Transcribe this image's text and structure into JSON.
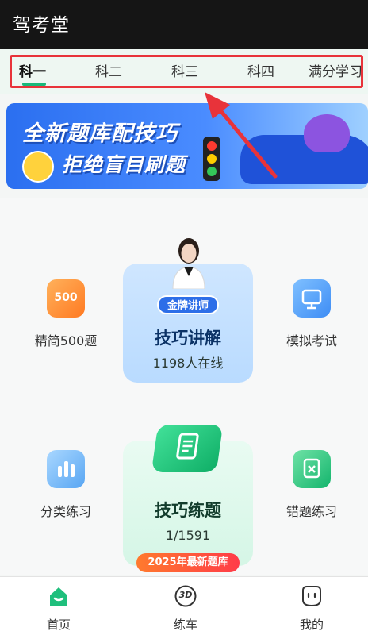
{
  "header": {
    "title": "驾考堂"
  },
  "tabs": [
    {
      "label": "科一",
      "active": true
    },
    {
      "label": "科二"
    },
    {
      "label": "科三"
    },
    {
      "label": "科四"
    },
    {
      "label": "满分学习"
    }
  ],
  "banner": {
    "line1": "全新题库配技巧",
    "line2": "拒绝盲目刷题"
  },
  "features": {
    "left_top": {
      "label": "精简500题",
      "icon": "500-icon",
      "icon_text": "500"
    },
    "right_top": {
      "label": "模拟考试",
      "icon": "monitor-icon"
    },
    "left_bottom": {
      "label": "分类练习",
      "icon": "bar-chart-icon"
    },
    "right_bottom": {
      "label": "错题练习",
      "icon": "wrong-doc-icon"
    }
  },
  "lecture_card": {
    "badge": "金牌讲师",
    "title": "技巧讲解",
    "subtitle": "1198人在线"
  },
  "practice_card": {
    "title": "技巧练题",
    "progress": "1/1591",
    "badge": "2025年最新题库"
  },
  "bottom_nav": [
    {
      "label": "首页",
      "icon": "home-icon",
      "active": true
    },
    {
      "label": "练车",
      "icon": "3d-icon",
      "icon_text": "3D"
    },
    {
      "label": "我的",
      "icon": "profile-face-icon"
    }
  ],
  "colors": {
    "accent": "#19b87a",
    "highlight": "#e8333a",
    "banner": "#2b6ff0"
  }
}
